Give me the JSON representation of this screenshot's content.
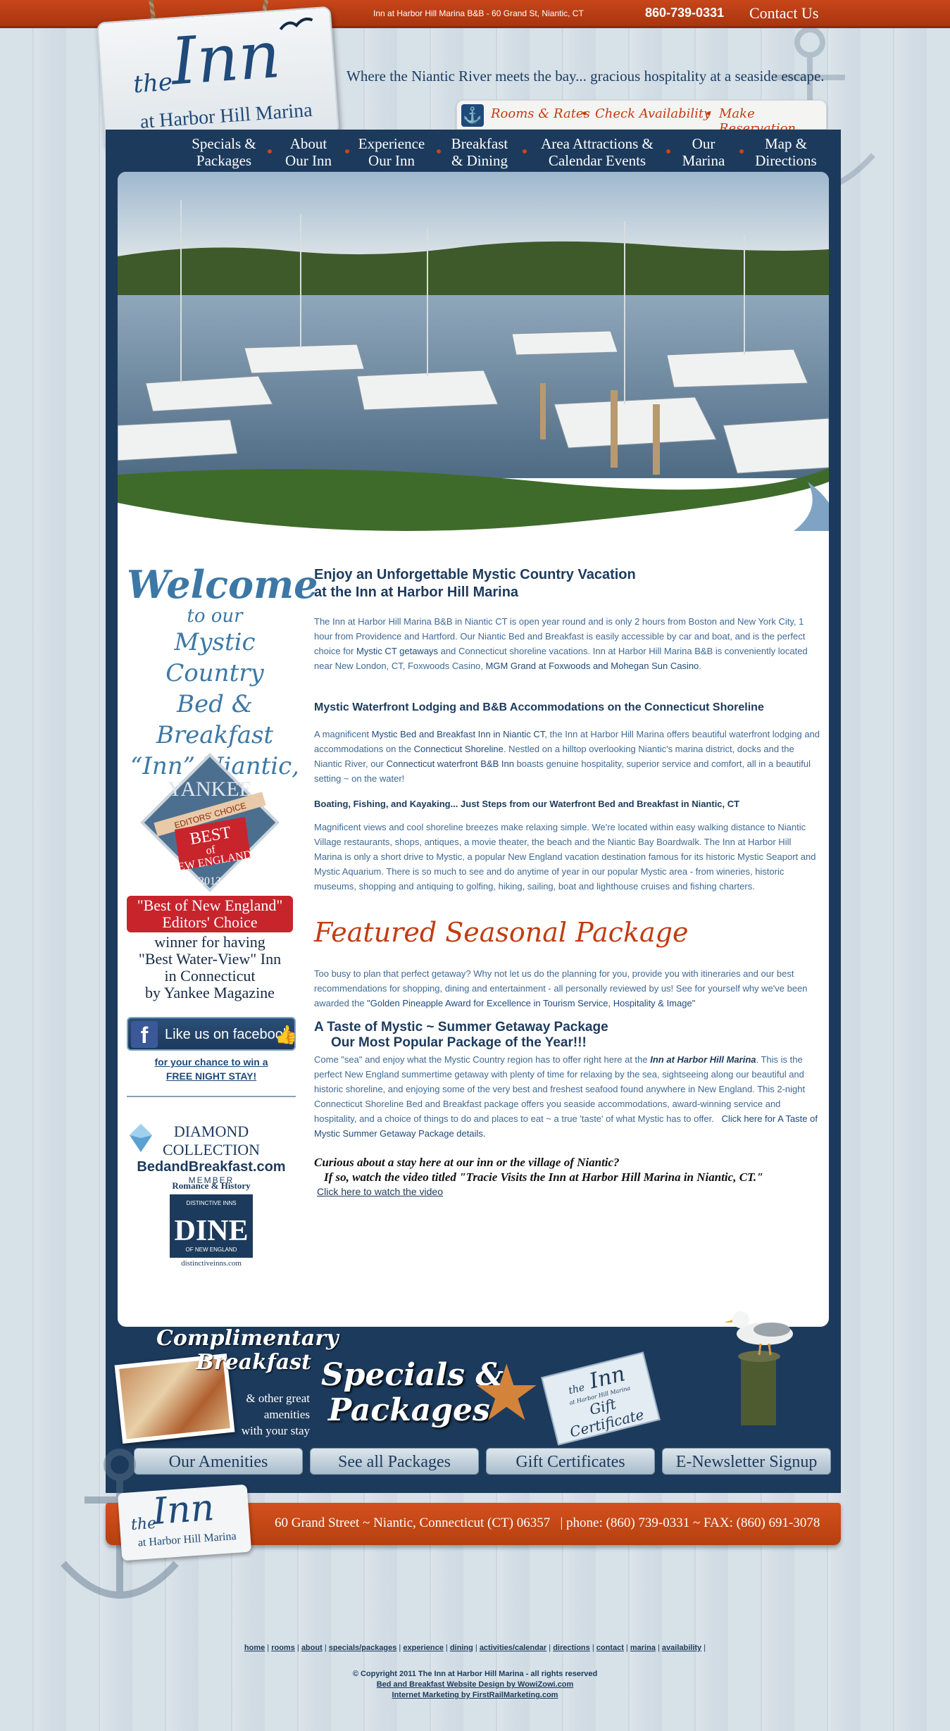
{
  "topbar": {
    "address": "Inn at Harbor Hill Marina B&B - 60 Grand St, Niantic, CT",
    "phone": "860-739-0331",
    "contact_label": "Contact Us"
  },
  "logo": {
    "the": "the",
    "inn": "Inn",
    "sub": "at Harbor Hill Marina"
  },
  "tagline": "Where the Niantic River meets the bay... gracious hospitality at a seaside escape.",
  "subnav": {
    "items": [
      "Rooms & Rates",
      "Check Availability",
      "Make Reservation"
    ],
    "separator": "•"
  },
  "mainnav": {
    "items": [
      {
        "line1": "Specials &",
        "line2": "Packages"
      },
      {
        "line1": "About",
        "line2": "Our Inn"
      },
      {
        "line1": "Experience",
        "line2": "Our Inn"
      },
      {
        "line1": "Breakfast",
        "line2": "& Dining"
      },
      {
        "line1": "Area Attractions &",
        "line2": "Calendar Events"
      },
      {
        "line1": "Our",
        "line2": "Marina"
      },
      {
        "line1": "Map &",
        "line2": "Directions"
      }
    ]
  },
  "sidebar": {
    "welcome": [
      "Welcome",
      "to our",
      "Mystic Country",
      "Bed & Breakfast",
      "“Inn” Niantic, CT"
    ],
    "yankee": {
      "brand": "YANKEE",
      "ribbon": "EDITORS' CHOICE",
      "best": "BEST",
      "of": "of",
      "ne": "NEW ENGLAND",
      "year": "2013"
    },
    "best_ne_line1": "\"Best of New England\"",
    "best_ne_line2": "Editors' Choice",
    "winner_lines": [
      "winner for having",
      "\"Best Water-View\" Inn",
      "in Connecticut",
      "by Yankee Magazine"
    ],
    "facebook_label": "Like us on facebook",
    "facebook_chance_1": "for your chance to win a",
    "facebook_chance_2": "FREE NIGHT STAY!",
    "diamond_1": "DIAMOND COLLECTION",
    "diamond_2": "BedandBreakfast.com",
    "diamond_3": "MEMBER",
    "dine_rh": "Romance & History",
    "dine_di": "DISTINCTIVE INNS",
    "dine_big": "DINE",
    "dine_ne": "OF NEW ENGLAND",
    "dine_url": "distinctiveinns.com"
  },
  "main": {
    "h1_prefix": "Enjoy an Unforgettable ",
    "h1_link": "Mystic Country Vacation",
    "h1_line2": "at the Inn at Harbor Hill Marina",
    "p1_a": "The Inn at Harbor Hill Marina B&B in Niantic CT is open year round and is only 2 hours from Boston and New York City, 1 hour from Providence and Hartford. Our Niantic Bed and Breakfast is easily accessible by car and boat, and is the perfect choice for ",
    "p1_link1": "Mystic CT getaways",
    "p1_b": " and Connecticut shoreline vacations. Inn at Harbor Hill Marina B&B is conveniently located near New London, CT, Foxwoods Casino, ",
    "p1_link2": "MGM Grand at Foxwoods and Mohegan Sun Casino",
    "p1_c": ".",
    "h2": "Mystic Waterfront Lodging and B&B Accommodations on the Connecticut Shoreline",
    "p2_a": "A magnificent ",
    "p2_link1": "Mystic Bed and Breakfast Inn in Niantic CT",
    "p2_b": ", the Inn at Harbor Hill Marina offers beautiful waterfront lodging and accommodations on the ",
    "p2_link2": "Connecticut Shoreline",
    "p2_c": ". Nestled on a hilltop overlooking Niantic's marina district, docks and the Niantic River, our ",
    "p2_link3": "Connecticut waterfront B&B Inn",
    "p2_d": " boasts genuine hospitality, superior service and comfort, all in a beautiful setting ~ on the water!",
    "h3": "Boating, Fishing, and Kayaking... Just Steps from our Waterfront Bed and Breakfast in Niantic, CT",
    "p3": "Magnificent views and cool shoreline breezes make relaxing simple. We're located within easy walking distance to Niantic Village restaurants, shops, antiques, a movie theater, the beach and the Niantic Bay Boardwalk. The Inn at Harbor Hill Marina is only a short drive to Mystic, a popular New England vacation destination famous for its historic Mystic Seaport and Mystic Aquarium. There is so much to see and do anytime of year in our popular Mystic area - from wineries, historic museums, shopping and antiquing to golfing, hiking, sailing, boat and lighthouse cruises and fishing charters.",
    "featured_title": "Featured Seasonal Package",
    "p4_a": "Too busy to plan that perfect getaway? Why not let us do the planning for you, provide you with itineraries and our best recommendations for shopping, dining and entertainment - all personally reviewed by us! See for yourself why we've been awarded the ",
    "p4_link": "\"Golden Pineapple Award for Excellence in Tourism Service, Hospitality & Image\"",
    "pkg_prefix": "A Taste of Mystic ~ Summer Getaway Package",
    "pkg_line2": "Our Most Popular Package of the Year!!!",
    "p5_a": "Come \"sea\" and enjoy what the Mystic Country region has to offer right here at the ",
    "p5_em": "Inn at Harbor Hill Marina",
    "p5_b": ". This is the perfect New England summertime getaway with plenty of time for relaxing by the sea, sightseeing along our beautiful and historic shoreline, and enjoying some of the very best and freshest seafood found anywhere in New England. This 2-night Connecticut Shoreline Bed and Breakfast package offers you seaside accommodations, award-winning service and hospitality, and a choice of things to do and places to eat ~ a true 'taste' of what Mystic has to offer.",
    "p5_link": "Click here for A Taste of Mystic Summer Getaway Package details.",
    "curious_1": "Curious about a stay here at our inn or the village of Niantic?",
    "curious_2": "If so, watch the video titled \"Tracie Visits the Inn at Harbor Hill Marina in Niantic, CT.\"",
    "video_link": "Click here to watch the video"
  },
  "promo": {
    "comp_title": "Complimentary Breakfast",
    "comp_sub": [
      "& other great",
      "amenities",
      "with your stay"
    ],
    "specials_line1": "Specials &",
    "specials_line2": "Packages",
    "gift_the": "the",
    "gift_inn": "Inn",
    "gift_sub": "at Harbor Hill Marina",
    "gift_cert": "Gift Certificate",
    "buttons": [
      "Our Amenities",
      "See all Packages",
      "Gift Certificates",
      "E-Newsletter Signup"
    ]
  },
  "footer": {
    "address": "60 Grand Street ~ Niantic, Connecticut (CT) 06357",
    "phones": "|  phone: (860) 739-0331 ~ FAX: (860) 691-3078",
    "links": [
      "home",
      "rooms",
      "about",
      "specials/packages",
      "experience",
      "dining",
      "activities/calendar",
      "directions",
      "contact",
      "marina",
      "availability"
    ],
    "copyright": "Copyright 2011 The Inn at Harbor Hill Marina - all rights reserved",
    "design": "Bed and Breakfast Website Design by WowiZowi.com",
    "marketing": "Internet Marketing by FirstRailMarketing.com"
  },
  "colors": {
    "accent_orange": "#c8461a",
    "navy": "#1c3a5c",
    "text_blue": "#3f6a93"
  }
}
